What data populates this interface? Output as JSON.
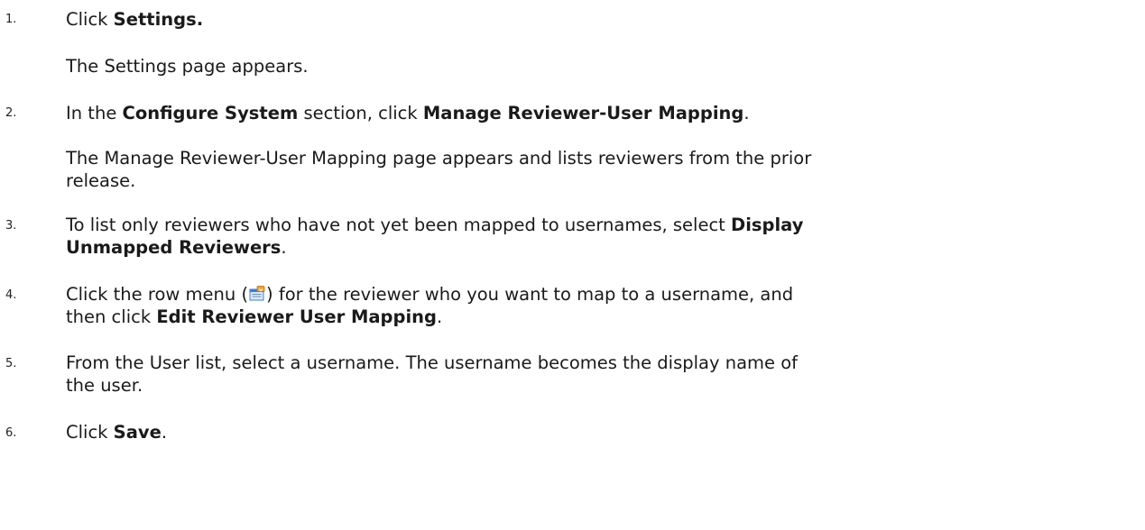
{
  "steps": [
    {
      "number": "1.",
      "parts": [
        "Click ",
        "Settings.",
        ""
      ],
      "result": "The Settings page appears."
    },
    {
      "number": "2.",
      "parts": [
        "In the ",
        "Configure System",
        " section, click ",
        "Manage Reviewer-User Mapping",
        "."
      ],
      "result_line1": "The Manage Reviewer-User Mapping page appears and lists reviewers from the prior",
      "result_line2": "release."
    },
    {
      "number": "3.",
      "line1_text": "To list only reviewers who have not yet been mapped to usernames, select ",
      "line1_bold": "Display",
      "line2_bold": "Unmapped Reviewers",
      "line2_text": "."
    },
    {
      "number": "4.",
      "line1_before": "Click the row menu (",
      "line1_after": ") for the reviewer who you want to map to a username, and",
      "line2_text": "then click ",
      "line2_bold": "Edit Reviewer User Mapping",
      "line2_end": "."
    },
    {
      "number": "5.",
      "line1": "From the User list, select a username. The username becomes the display name of",
      "line2": "the user."
    },
    {
      "number": "6.",
      "parts": [
        "Click ",
        "Save",
        "."
      ]
    }
  ],
  "icons": {
    "row_menu": "row-menu-icon",
    "colors": {
      "menu_blue": "#3a7fd5",
      "menu_orange": "#e8a23a"
    }
  }
}
